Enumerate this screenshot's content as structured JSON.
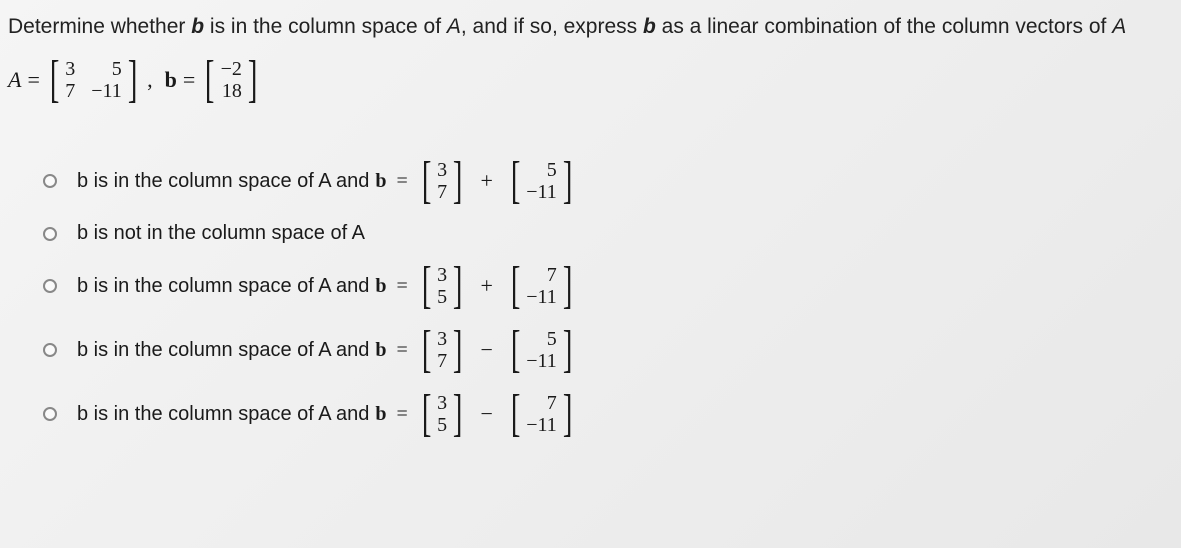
{
  "question": {
    "prefix": "Determine whether ",
    "b1": "b",
    "mid1": " is in the column space of ",
    "A1": "A",
    "mid2": ", and if so, express ",
    "b2": "b",
    "mid3": " as a linear combination of the column vectors of ",
    "A2": "A"
  },
  "setup": {
    "A_label": "A",
    "eq": "=",
    "A": {
      "r1c1": "3",
      "r1c2": "5",
      "r2c1": "7",
      "r2c2": "−11"
    },
    "comma": ",",
    "b_label": "b",
    "b": {
      "r1": "−2",
      "r2": "18"
    }
  },
  "options": {
    "opt1": {
      "text": "b is in the column space of A and ",
      "b_lbl": "b",
      "eq": "=",
      "v1": {
        "r1": "3",
        "r2": "7"
      },
      "op": "+",
      "v2": {
        "r1": "5",
        "r2": "−11"
      }
    },
    "opt2": {
      "text": "b is not in the column space of A"
    },
    "opt3": {
      "text": "b is in the column space of A and ",
      "b_lbl": "b",
      "eq": "=",
      "v1": {
        "r1": "3",
        "r2": "5"
      },
      "op": "+",
      "v2": {
        "r1": "7",
        "r2": "−11"
      }
    },
    "opt4": {
      "text": "b is in the column space of A and ",
      "b_lbl": "b",
      "eq": "=",
      "v1": {
        "r1": "3",
        "r2": "7"
      },
      "op": "−",
      "v2": {
        "r1": "5",
        "r2": "−11"
      }
    },
    "opt5": {
      "text": "b is in the column space of A and ",
      "b_lbl": "b",
      "eq": "=",
      "v1": {
        "r1": "3",
        "r2": "5"
      },
      "op": "−",
      "v2": {
        "r1": "7",
        "r2": "−11"
      }
    }
  }
}
